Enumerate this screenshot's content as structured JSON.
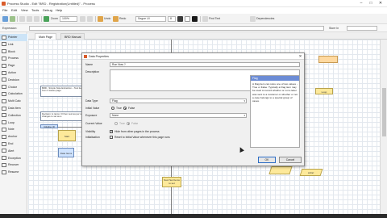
{
  "window": {
    "title": "Process Studio - Edit \"BRD - Registration(Untitled)\" - Process",
    "controls": [
      "–",
      "□",
      "✕"
    ]
  },
  "menu": [
    "File",
    "Edit",
    "View",
    "Tools",
    "Debug",
    "Help"
  ],
  "toolbar": {
    "zoom_label": "Zoom",
    "zoom_value": "100%",
    "font_value": "Segoe UI",
    "font_size": "8",
    "find_text_label": "Find Text",
    "dependencies_label": "Dependencies",
    "undo_label": "Undo",
    "redo_label": "Redo"
  },
  "expression_bar": {
    "label": "Expression:",
    "store_label": "Store In",
    "store_value": ""
  },
  "toolbox": {
    "items": [
      {
        "label": "Pointer",
        "selected": true
      },
      {
        "label": "Link"
      },
      {
        "label": "Block"
      },
      {
        "label": "Process"
      },
      {
        "label": "Page"
      },
      {
        "label": "Action"
      },
      {
        "label": "Decision"
      },
      {
        "label": "Choice"
      },
      {
        "label": "Calculation"
      },
      {
        "label": "Multi Calc"
      },
      {
        "label": "Data Item"
      },
      {
        "label": "Collection"
      },
      {
        "label": "Loop"
      },
      {
        "label": "Note"
      },
      {
        "label": "Anchor"
      },
      {
        "label": "End"
      },
      {
        "label": "Alert"
      },
      {
        "label": "Exception"
      },
      {
        "label": "Recover"
      },
      {
        "label": "Resume"
      }
    ]
  },
  "tabs": [
    {
      "label": "Main Page",
      "active": true
    },
    {
      "label": "BRD Manual"
    }
  ],
  "canvas": {
    "note_text": "BRD - Simple Note Extraction – Test items: from 3 issues page.",
    "note2_text": "Decision: is items >0 then next as per set changes to set as a",
    "note3_text": "Initialise (if)",
    "start_label": "Start",
    "small_label": "Data Items",
    "bottom_label": "Next Set Items to set",
    "right_label": "Loop",
    "right_label2": "Done"
  },
  "dialog": {
    "title": "Data Properties",
    "name_label": "Name",
    "name_value": "Run Now ?",
    "description_label": "Description",
    "description_value": "",
    "data_type_label": "Data Type",
    "data_type_value": "Flag",
    "initial_value_label": "Initial Value",
    "radio_true": "True",
    "radio_false": "False",
    "initial_selected": "False",
    "exposure_label": "Exposure",
    "exposure_value": "None",
    "current_value_label": "Current Value",
    "current_true": "True",
    "current_false": "False",
    "visibility_label": "Visibility",
    "visibility_check": "Hide from other pages in the process",
    "initialisation_label": "Initialisation",
    "initialisation_check": "Reset to Initial Value whenever this page runs",
    "ok_label": "OK",
    "cancel_label": "Cancel",
    "help": {
      "heading": "Flag",
      "body": "A Flag item can store one of two values - True or False. Typically a Flag item may be used to record whether or not a letter was sent to a customer or whether or not a case belongs to a special group of cases."
    }
  }
}
